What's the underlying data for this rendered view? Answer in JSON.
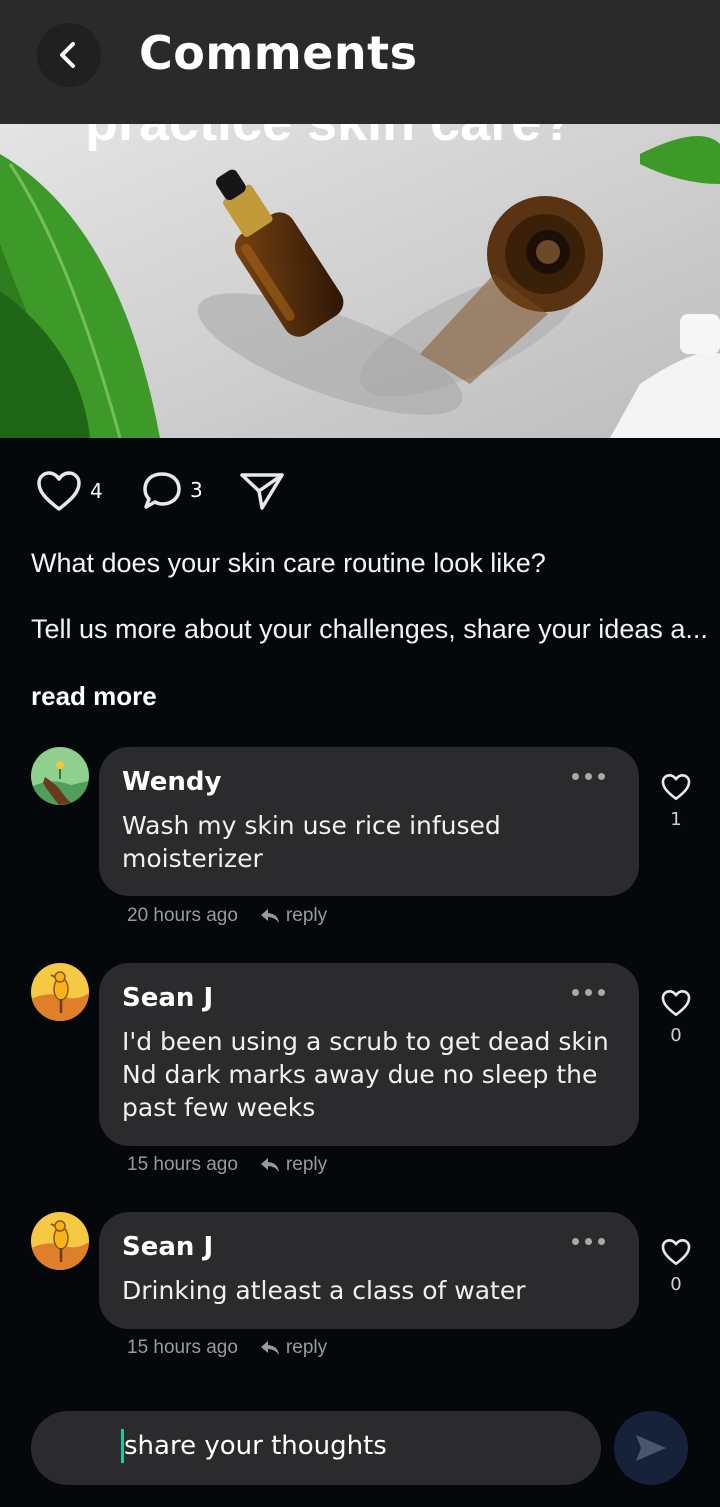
{
  "header": {
    "title": "Comments"
  },
  "post": {
    "image_caption": "practice skin care?",
    "likes": "4",
    "comments": "3",
    "description_line1": "What does your skin care routine look like?",
    "description_line2": "Tell us more about your challenges, share your ideas a...",
    "read_more": "read more"
  },
  "comments": [
    {
      "name": "Wendy",
      "text": "Wash my skin use rice infused moisterizer",
      "likes": "1",
      "time": "20 hours ago",
      "reply": "reply"
    },
    {
      "name": "Sean J",
      "text": "I'd been using a scrub to get dead skin Nd dark marks away due no sleep the past few weeks",
      "likes": "0",
      "time": "15 hours ago",
      "reply": "reply"
    },
    {
      "name": "Sean J",
      "text": "Drinking atleast a class of water",
      "likes": "0",
      "time": "15 hours ago",
      "reply": "reply"
    }
  ],
  "composer": {
    "placeholder": "share your thoughts"
  },
  "icons": {
    "back": "chevron-left-icon",
    "like": "heart-icon",
    "comment": "speech-bubble-icon",
    "share": "paper-plane-icon",
    "more": "more-dots-icon",
    "reply": "reply-arrow-icon",
    "send": "send-icon"
  },
  "colors": {
    "background": "#05080b",
    "header": "#2a2a2a",
    "bubble": "#2b2b2d",
    "send": "#16213a",
    "cursor": "#1ec8a5"
  }
}
